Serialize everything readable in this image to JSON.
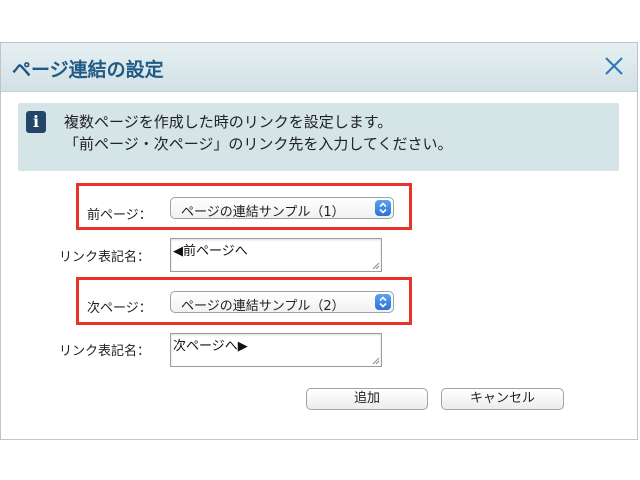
{
  "dialog": {
    "title": "ページ連結の設定",
    "close_icon": "close-icon",
    "info": {
      "icon": "info-icon",
      "icon_glyph": "i",
      "line1": "複数ページを作成した時のリンクを設定します。",
      "line2": "「前ページ・次ページ」のリンク先を入力してください。"
    },
    "prev": {
      "label": "前ページ：",
      "selected": "ページの連結サンプル（1）",
      "link_label": "リンク表記名：",
      "link_value": "◀前ページへ"
    },
    "next": {
      "label": "次ページ：",
      "selected": "ページの連結サンプル（2）",
      "link_label": "リンク表記名：",
      "link_value": "次ページへ▶"
    },
    "buttons": {
      "add": "追加",
      "cancel": "キャンセル"
    }
  },
  "colors": {
    "title_text": "#1f5a85",
    "highlight": "#e8322a",
    "info_bg": "#d4e4e7",
    "info_icon_bg": "#24456a",
    "select_arrow": "#2c72d8"
  }
}
